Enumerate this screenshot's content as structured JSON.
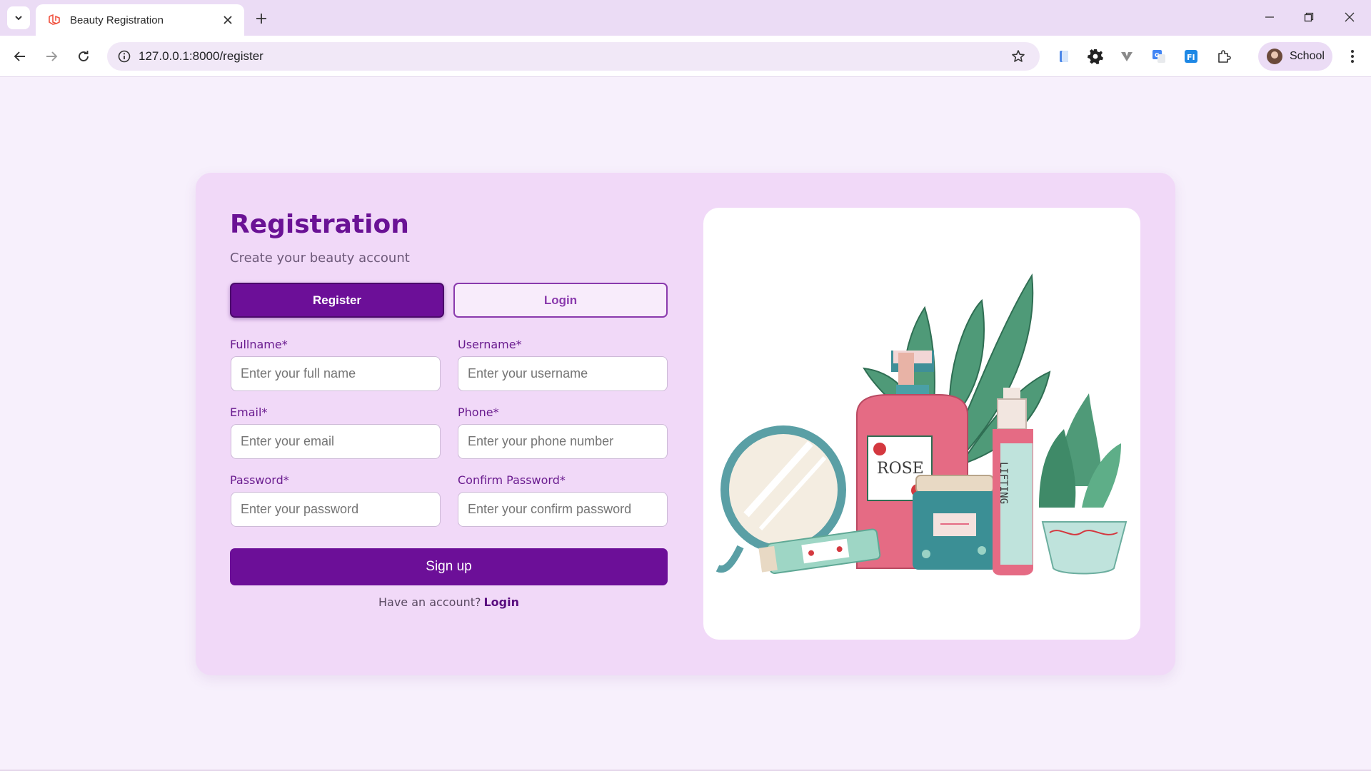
{
  "browser": {
    "tab_title": "Beauty Registration",
    "url": "127.0.0.1:8000/register",
    "profile_name": "School"
  },
  "page": {
    "title": "Registration",
    "subtitle": "Create your beauty account",
    "tabs": {
      "register": "Register",
      "login": "Login"
    },
    "fields": {
      "fullname": {
        "label": "Fullname*",
        "placeholder": "Enter your full name",
        "value": ""
      },
      "username": {
        "label": "Username*",
        "placeholder": "Enter your username",
        "value": ""
      },
      "email": {
        "label": "Email*",
        "placeholder": "Enter your email",
        "value": ""
      },
      "phone": {
        "label": "Phone*",
        "placeholder": "Enter your phone number",
        "value": ""
      },
      "password": {
        "label": "Password*",
        "placeholder": "Enter your password",
        "value": ""
      },
      "confirm_password": {
        "label": "Confirm Password*",
        "placeholder": "Enter your confirm password",
        "value": ""
      }
    },
    "signup_label": "Sign up",
    "footer": {
      "prompt": "Have an account?",
      "link": "Login"
    },
    "illustration": {
      "rose_label": "ROSE",
      "lifting_label": "LIFTING"
    }
  },
  "colors": {
    "primary": "#6c0f98",
    "card_bg": "#f1d9f8",
    "page_bg": "#f7f0fc",
    "accent_text": "#8a3aad"
  }
}
